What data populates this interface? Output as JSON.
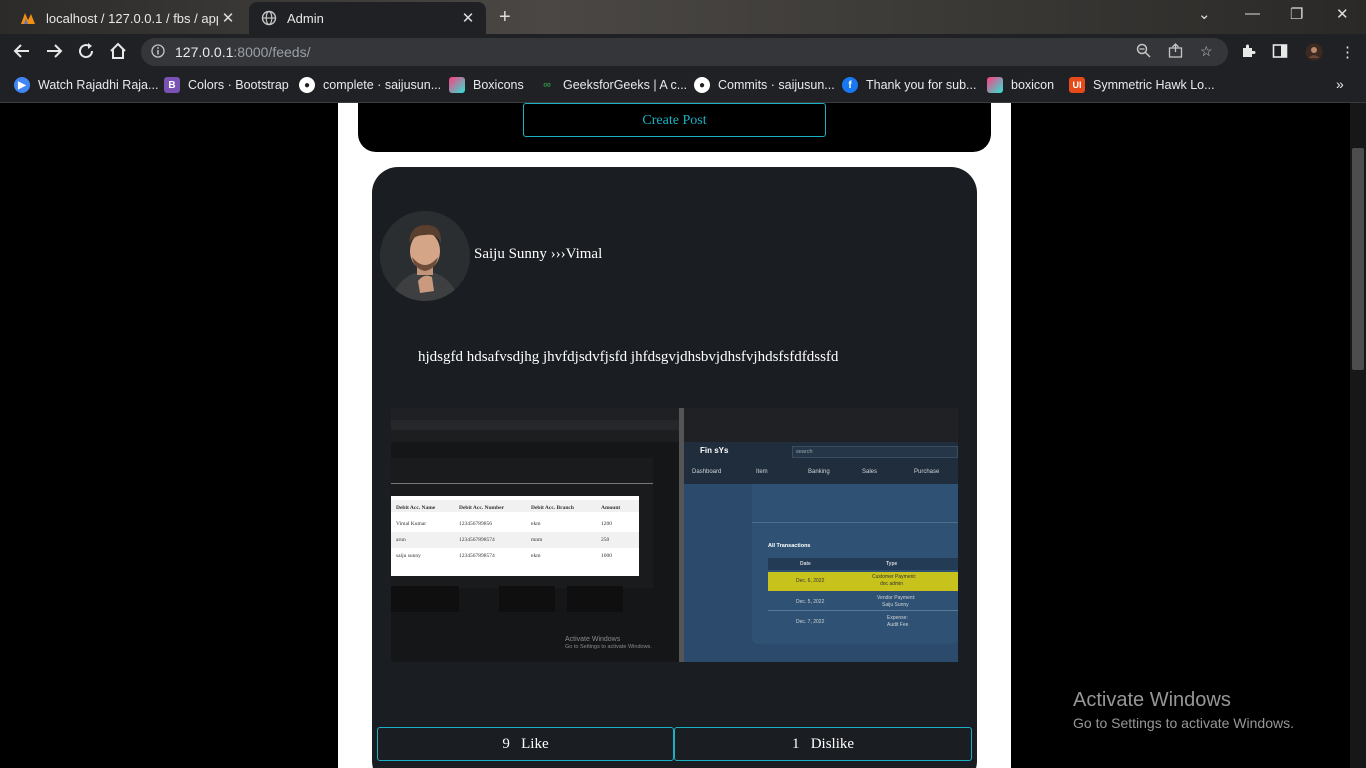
{
  "browser": {
    "tabs": [
      {
        "title": "localhost / 127.0.0.1 / fbs / app1",
        "active": false,
        "icon": "phpmyadmin-icon"
      },
      {
        "title": "Admin",
        "active": true,
        "icon": "globe-icon"
      }
    ],
    "url_host": "127.0.0.1",
    "url_path": ":8000/feeds/",
    "bookmarks": [
      {
        "label": "Watch Rajadhi Raja...",
        "icon": "play-icon",
        "color": "#4285f4"
      },
      {
        "label": "Colors · Bootstrap",
        "icon": "bootstrap-icon",
        "color": "#7952b3"
      },
      {
        "label": "complete · saijusun...",
        "icon": "github-icon",
        "color": "#ffffff"
      },
      {
        "label": "Boxicons",
        "icon": "boxicons-icon",
        "color": "#ff3c7f"
      },
      {
        "label": "GeeksforGeeks | A c...",
        "icon": "geeksforgeeks-icon",
        "color": "#2f8d46"
      },
      {
        "label": "Commits · saijusun...",
        "icon": "github-icon",
        "color": "#ffffff"
      },
      {
        "label": "Thank you for sub...",
        "icon": "facebook-icon",
        "color": "#1877f2"
      },
      {
        "label": "boxicon",
        "icon": "boxicons-icon",
        "color": "#ff3c7f"
      },
      {
        "label": "Symmetric Hawk Lo...",
        "icon": "ui-icon",
        "color": "#e64a19"
      }
    ]
  },
  "page": {
    "create_post_label": "Create Post",
    "post": {
      "author": "Saiju Sunny ›››Vimal",
      "text": "hjdsgfd hdsafvsdjhg jhvfdjsdvfjsfd jhfdsgvjdhsbvjdhsfvjhdsfsfdfdssfd",
      "likes": "9",
      "like_label": "Like",
      "dislikes": "1",
      "dislike_label": "Dislike",
      "image": {
        "table_headers": [
          "Debit Acc. Name",
          "Debit Acc. Number",
          "Debit Acc. Branch",
          "Amount"
        ],
        "table_rows": [
          [
            "Vimal Kumar",
            "123456789856",
            "ekm",
            "1200"
          ],
          [
            "arun",
            "1234567898574",
            "mnm",
            "250"
          ],
          [
            "saiju sunny",
            "1234567898574",
            "ekm",
            "1000"
          ]
        ],
        "app_name": "Fin sYs",
        "search_placeholder": "search",
        "menu": [
          "Dashboard",
          "Item",
          "Banking",
          "Sales",
          "Purchase"
        ],
        "section_title": "All Transactions",
        "tx_headers": [
          "Date",
          "Type"
        ],
        "transactions": [
          {
            "date": "Dec. 6, 2022",
            "type": "Customer Payment:",
            "sub": "doc admin"
          },
          {
            "date": "Dec. 5, 2022",
            "type": "Vendor Payment:",
            "sub": "Saiju Sunny"
          },
          {
            "date": "Dec. 7, 2022",
            "type": "Expense:",
            "sub": "Audit Fee"
          }
        ],
        "watermark_1": "Activate Windows",
        "watermark_2": "Go to Settings to activate Windows."
      }
    }
  },
  "os_watermark": {
    "line1": "Activate Windows",
    "line2": "Go to Settings to activate Windows."
  },
  "colors": {
    "accent": "#1ab1c4",
    "card_bg": "#1a1d22",
    "highlight_row": "#c8c21c"
  }
}
